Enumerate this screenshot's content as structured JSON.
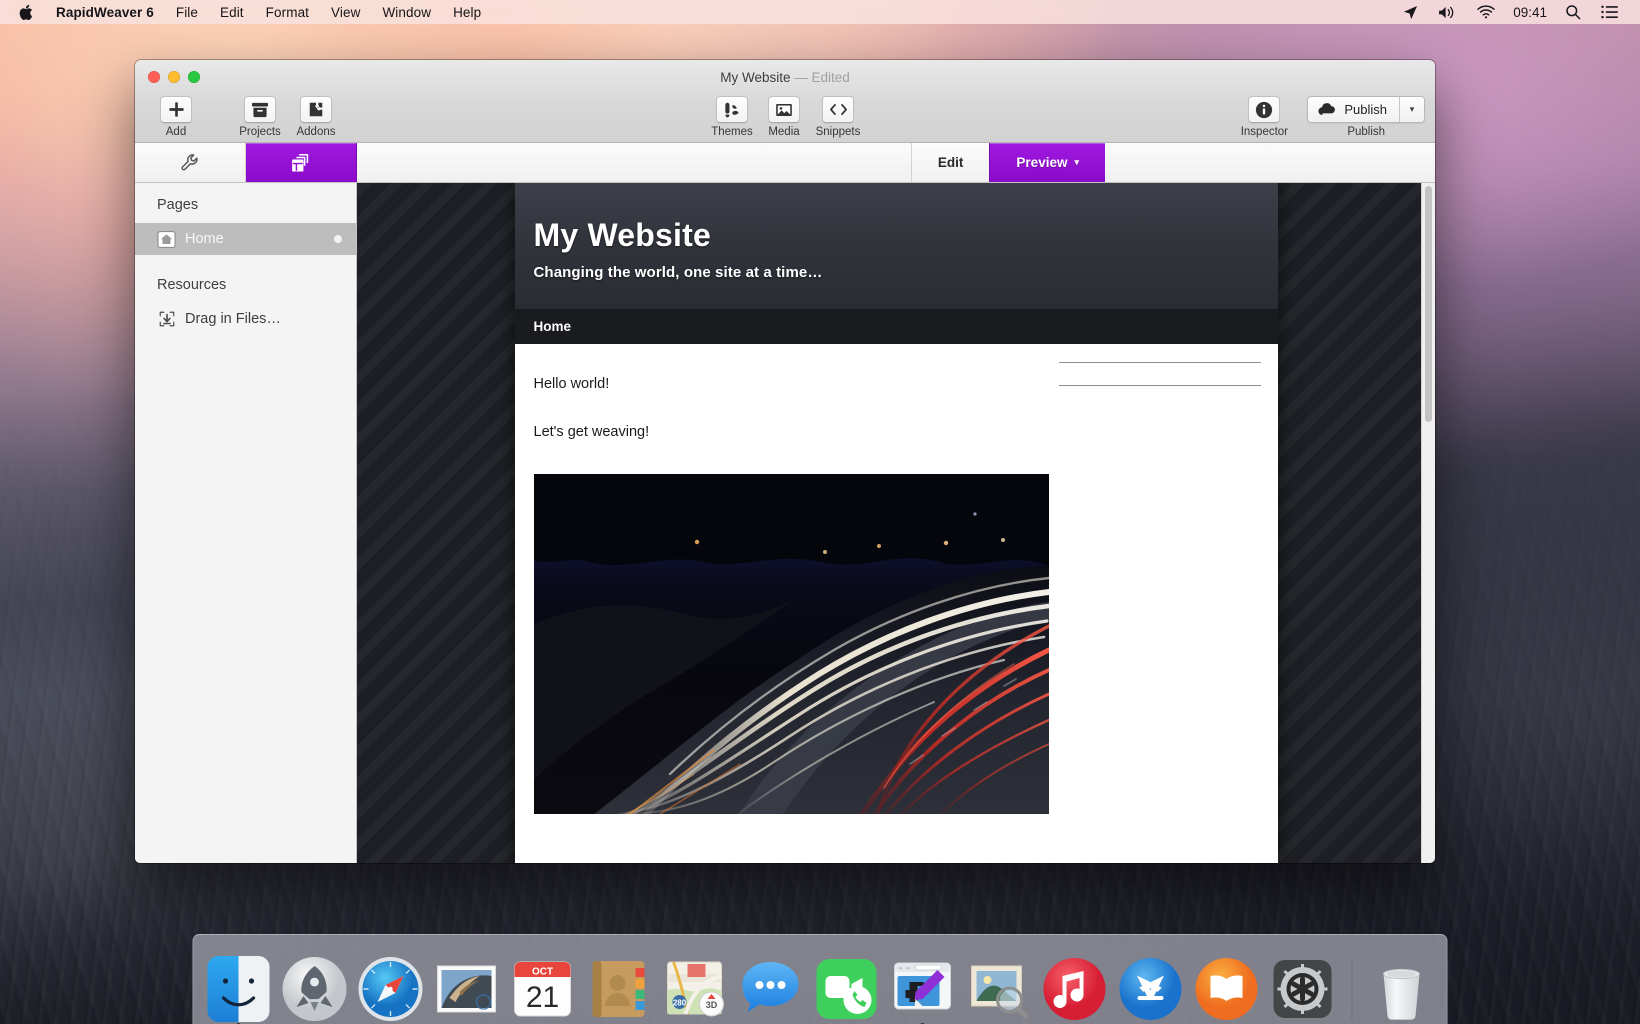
{
  "menubar": {
    "apple_icon": "apple-logo-icon",
    "app_name": "RapidWeaver 6",
    "menus": [
      "File",
      "Edit",
      "Format",
      "View",
      "Window",
      "Help"
    ],
    "status_icons": [
      "location-arrow-icon",
      "volume-icon",
      "wifi-icon"
    ],
    "clock": "09:41",
    "right_icons": [
      "search-icon",
      "notification-center-icon"
    ]
  },
  "window": {
    "title": "My Website",
    "title_separator": "—",
    "edited_status": "Edited",
    "toolbar": {
      "left_buttons": [
        {
          "label": "Add",
          "icon": "plus-icon"
        },
        {
          "label": "Projects",
          "icon": "archive-box-icon"
        },
        {
          "label": "Addons",
          "icon": "puzzle-piece-icon"
        }
      ],
      "center_buttons": [
        {
          "label": "Themes",
          "icon": "paint-brush-icon"
        },
        {
          "label": "Media",
          "icon": "photo-icon"
        },
        {
          "label": "Snippets",
          "icon": "code-brackets-icon"
        }
      ],
      "inspector": {
        "label": "Inspector",
        "icon": "info-circle-icon"
      },
      "publish": {
        "label": "Publish",
        "caption": "Publish",
        "icon": "cloud-upload-icon",
        "menu_caret": "▾"
      }
    },
    "modebar": {
      "segments": [
        {
          "name": "settings-segment",
          "icon": "wrench-icon",
          "active": false
        },
        {
          "name": "pages-segment",
          "icon": "pages-stack-icon",
          "active": true
        }
      ],
      "edit_label": "Edit",
      "preview_label": "Preview",
      "preview_caret": "▾",
      "active_mode": "Preview",
      "accent_color": "#9413d4"
    },
    "sidebar": {
      "pages_header": "Pages",
      "pages": [
        {
          "label": "Home",
          "icon": "home-page-icon",
          "selected": true,
          "status_dot": true
        }
      ],
      "resources_header": "Resources",
      "drop_zone": {
        "label": "Drag in Files…",
        "icon": "download-into-box-icon"
      }
    },
    "preview": {
      "site_title": "My Website",
      "site_slogan": "Changing the world, one site at a time…",
      "nav_items": [
        "Home"
      ],
      "content": [
        "Hello world!",
        "Let's get weaving!"
      ],
      "photo_alt": "night-highway-light-trails-photo"
    }
  },
  "dock": {
    "items": [
      {
        "name": "finder",
        "label": "Finder",
        "running": true
      },
      {
        "name": "launchpad",
        "label": "Launchpad",
        "running": false
      },
      {
        "name": "safari",
        "label": "Safari",
        "running": false
      },
      {
        "name": "mail",
        "label": "Mail",
        "running": false
      },
      {
        "name": "calendar",
        "label": "Calendar",
        "running": false,
        "month": "OCT",
        "day": "21"
      },
      {
        "name": "contacts",
        "label": "Contacts",
        "running": false
      },
      {
        "name": "maps",
        "label": "Maps",
        "running": false,
        "badge": "3D",
        "route": "280"
      },
      {
        "name": "messages",
        "label": "Messages",
        "running": false
      },
      {
        "name": "facetime",
        "label": "FaceTime",
        "running": false
      },
      {
        "name": "rapidweaver",
        "label": "RapidWeaver",
        "running": true
      },
      {
        "name": "preview",
        "label": "Preview",
        "running": false
      },
      {
        "name": "itunes",
        "label": "iTunes",
        "running": false
      },
      {
        "name": "app-store",
        "label": "App Store",
        "running": false
      },
      {
        "name": "ibooks",
        "label": "iBooks",
        "running": false
      },
      {
        "name": "system-preferences",
        "label": "System Preferences",
        "running": false
      }
    ],
    "trash": {
      "name": "trash",
      "label": "Trash"
    }
  }
}
